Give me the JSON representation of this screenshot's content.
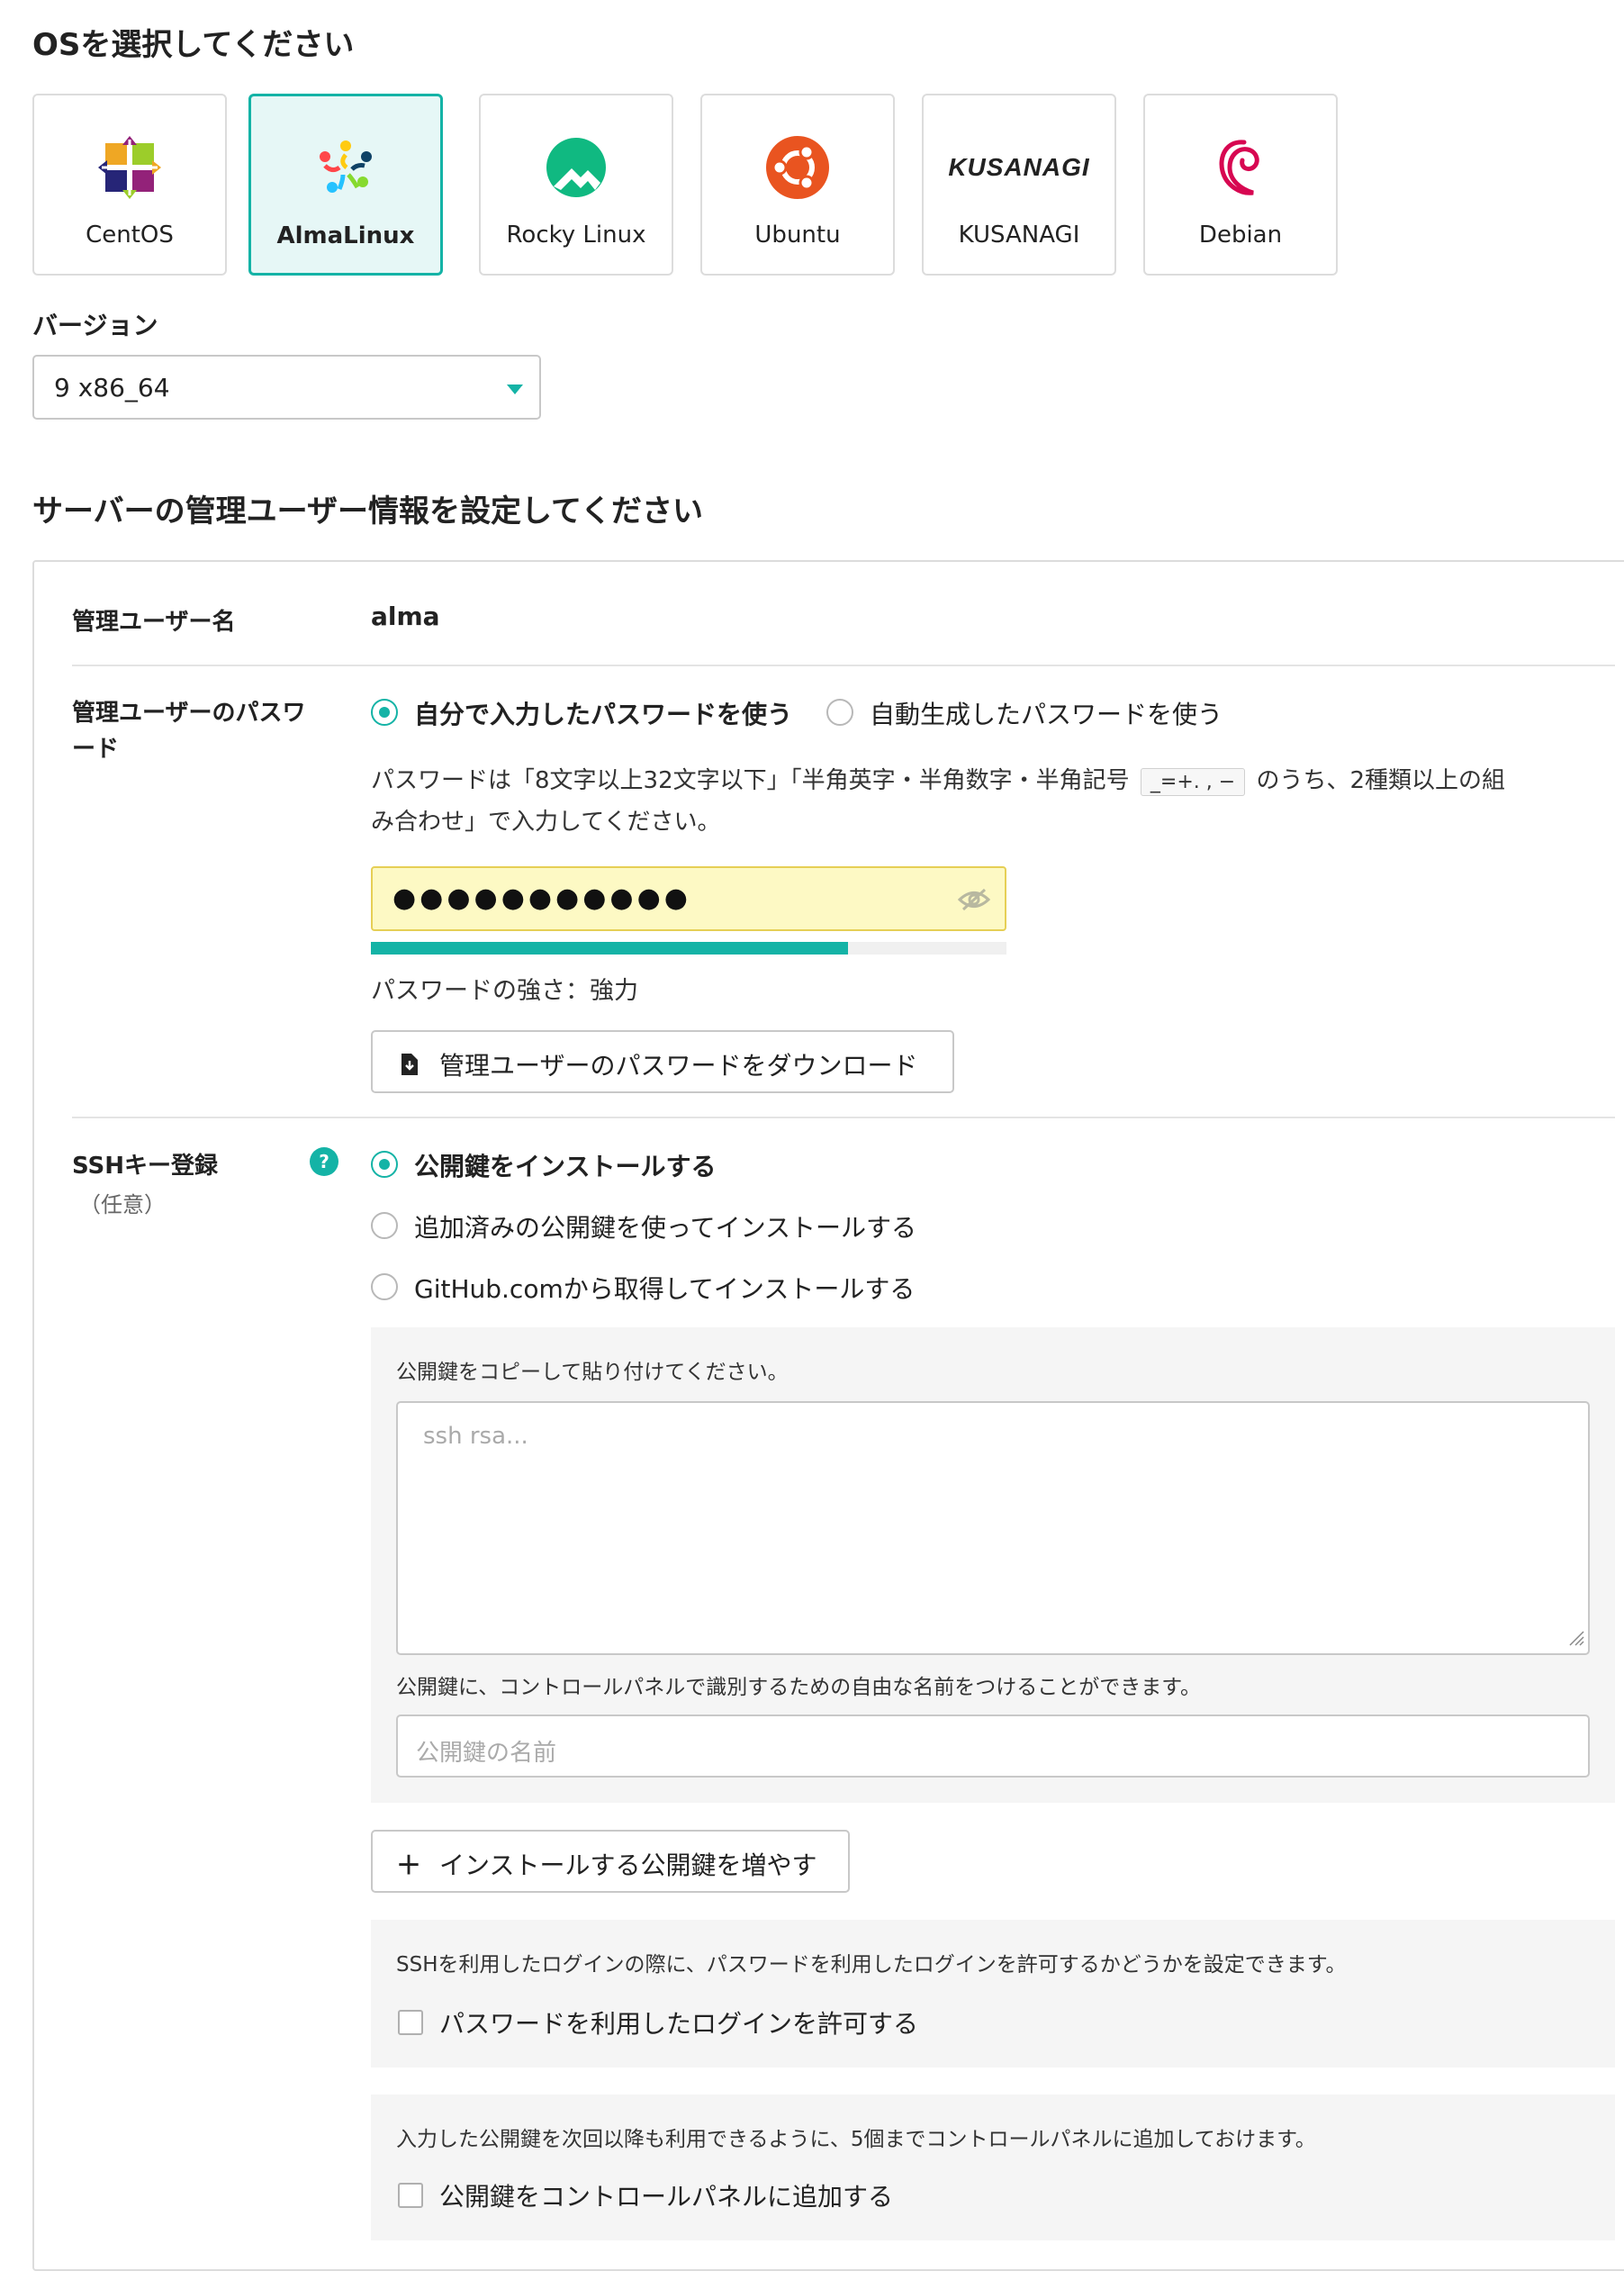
{
  "os_section": {
    "title": "OSを選択してください",
    "options": [
      {
        "name": "CentOS",
        "icon": "centos-logo-icon"
      },
      {
        "name": "AlmaLinux",
        "icon": "almalinux-logo-icon",
        "selected": true
      },
      {
        "name": "Rocky Linux",
        "icon": "rocky-linux-logo-icon"
      },
      {
        "name": "Ubuntu",
        "icon": "ubuntu-logo-icon"
      },
      {
        "name": "KUSANAGI",
        "icon": "kusanagi-logo-icon",
        "logo_text": "KUSANAGI"
      },
      {
        "name": "Debian",
        "icon": "debian-logo-icon"
      }
    ]
  },
  "version": {
    "label": "バージョン",
    "value": "9 x86_64"
  },
  "admin_section": {
    "title": "サーバーの管理ユーザー情報を設定してください",
    "username": {
      "label": "管理ユーザー名",
      "value": "alma"
    },
    "password": {
      "label_line1": "管理ユーザーのパスワ",
      "label_line2": "ード",
      "option_manual": "自分で入力したパスワードを使う",
      "option_auto": "自動生成したパスワードを使う",
      "hint_before": "パスワードは「8文字以上32文字以下」「半角英字・半角数字・半角記号",
      "hint_symbols": "_=+. , −",
      "hint_after": "のうち、2種類以上の組",
      "hint_line2": "み合わせ」で入力してください。",
      "masked_value": "●●●●●●●●●●●",
      "strength_fraction": 0.75,
      "strength_text": "パスワードの強さ：強力",
      "download_button": "管理ユーザーのパスワードをダウンロード"
    },
    "ssh": {
      "label": "SSHキー登録",
      "sublabel": "（任意）",
      "help": "?",
      "option_install": "公開鍵をインストールする",
      "option_existing": "追加済みの公開鍵を使ってインストールする",
      "option_github": "GitHub.comから取得してインストールする",
      "paste_instruction": "公開鍵をコピーして貼り付けてください。",
      "key_placeholder": "ssh rsa...",
      "name_instruction": "公開鍵に、コントロールパネルで識別するための自由な名前をつけることができます。",
      "name_placeholder": "公開鍵の名前",
      "add_key_button": "インストールする公開鍵を増やす",
      "add_key_icon": "＋",
      "password_login_note": "SSHを利用したログインの際に、パスワードを利用したログインを許可するかどうかを設定できます。",
      "password_login_check": "パスワードを利用したログインを許可する",
      "save_key_note": "入力した公開鍵を次回以降も利用できるように、5個までコントロールパネルに追加しておけます。",
      "save_key_check": "公開鍵をコントロールパネルに追加する"
    }
  },
  "colors": {
    "accent": "#14b3a6",
    "password_bg": "#fdf9c4",
    "password_border": "#e6cf55"
  }
}
